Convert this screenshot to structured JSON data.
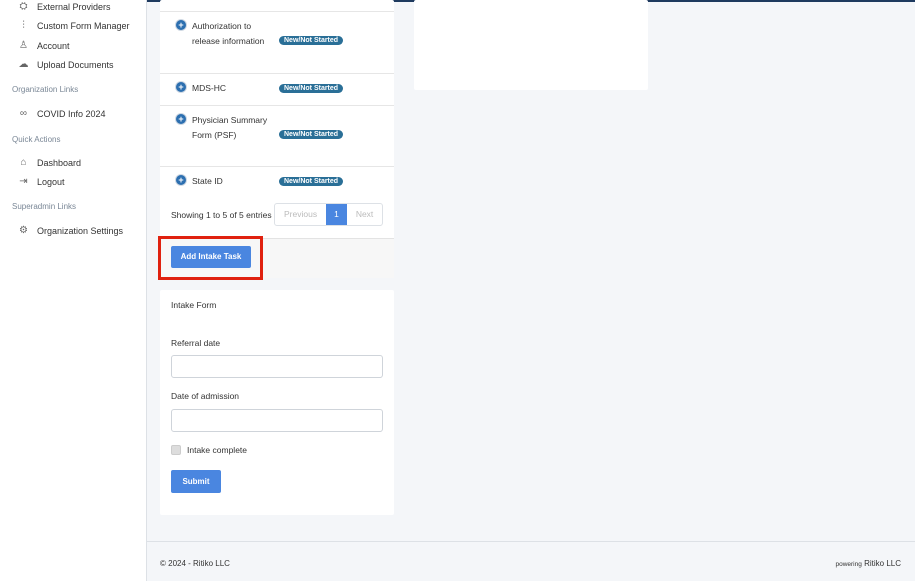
{
  "sidebar": {
    "items": [
      {
        "label": "External Providers",
        "icon": "users-icon"
      },
      {
        "label": "Custom Form Manager",
        "icon": "sliders-icon"
      },
      {
        "label": "Account",
        "icon": "user-icon"
      },
      {
        "label": "Upload Documents",
        "icon": "cloud-upload-icon"
      }
    ],
    "org_header": "Organization Links",
    "org_items": [
      {
        "label": "COVID Info 2024",
        "icon": "link-icon"
      }
    ],
    "quick_header": "Quick Actions",
    "quick_items": [
      {
        "label": "Dashboard",
        "icon": "home-icon"
      },
      {
        "label": "Logout",
        "icon": "logout-icon"
      }
    ],
    "super_header": "Superadmin Links",
    "super_items": [
      {
        "label": "Organization Settings",
        "icon": "gear-icon"
      }
    ]
  },
  "tasks": {
    "rows": [
      {
        "name": "Authorization to release information",
        "status": "New/Not Started"
      },
      {
        "name": "MDS-HC",
        "status": "New/Not Started"
      },
      {
        "name": "Physician Summary Form (PSF)",
        "status": "New/Not Started"
      },
      {
        "name": "State ID",
        "status": "New/Not Started"
      }
    ],
    "info": "Showing 1 to 5 of 5 entries",
    "pagination": {
      "previous": "Previous",
      "page": "1",
      "next": "Next"
    },
    "add_button": "Add Intake Task",
    "badge_color": "#2a6f97"
  },
  "intake_form": {
    "title": "Intake Form",
    "referral_label": "Referral date",
    "referral_value": "",
    "admission_label": "Date of admission",
    "admission_value": "",
    "complete_label": "Intake complete",
    "submit": "Submit"
  },
  "footer": {
    "copyright": "© 2024 - Ritiko LLC",
    "powering": "powering",
    "brand": "Ritiko LLC"
  }
}
